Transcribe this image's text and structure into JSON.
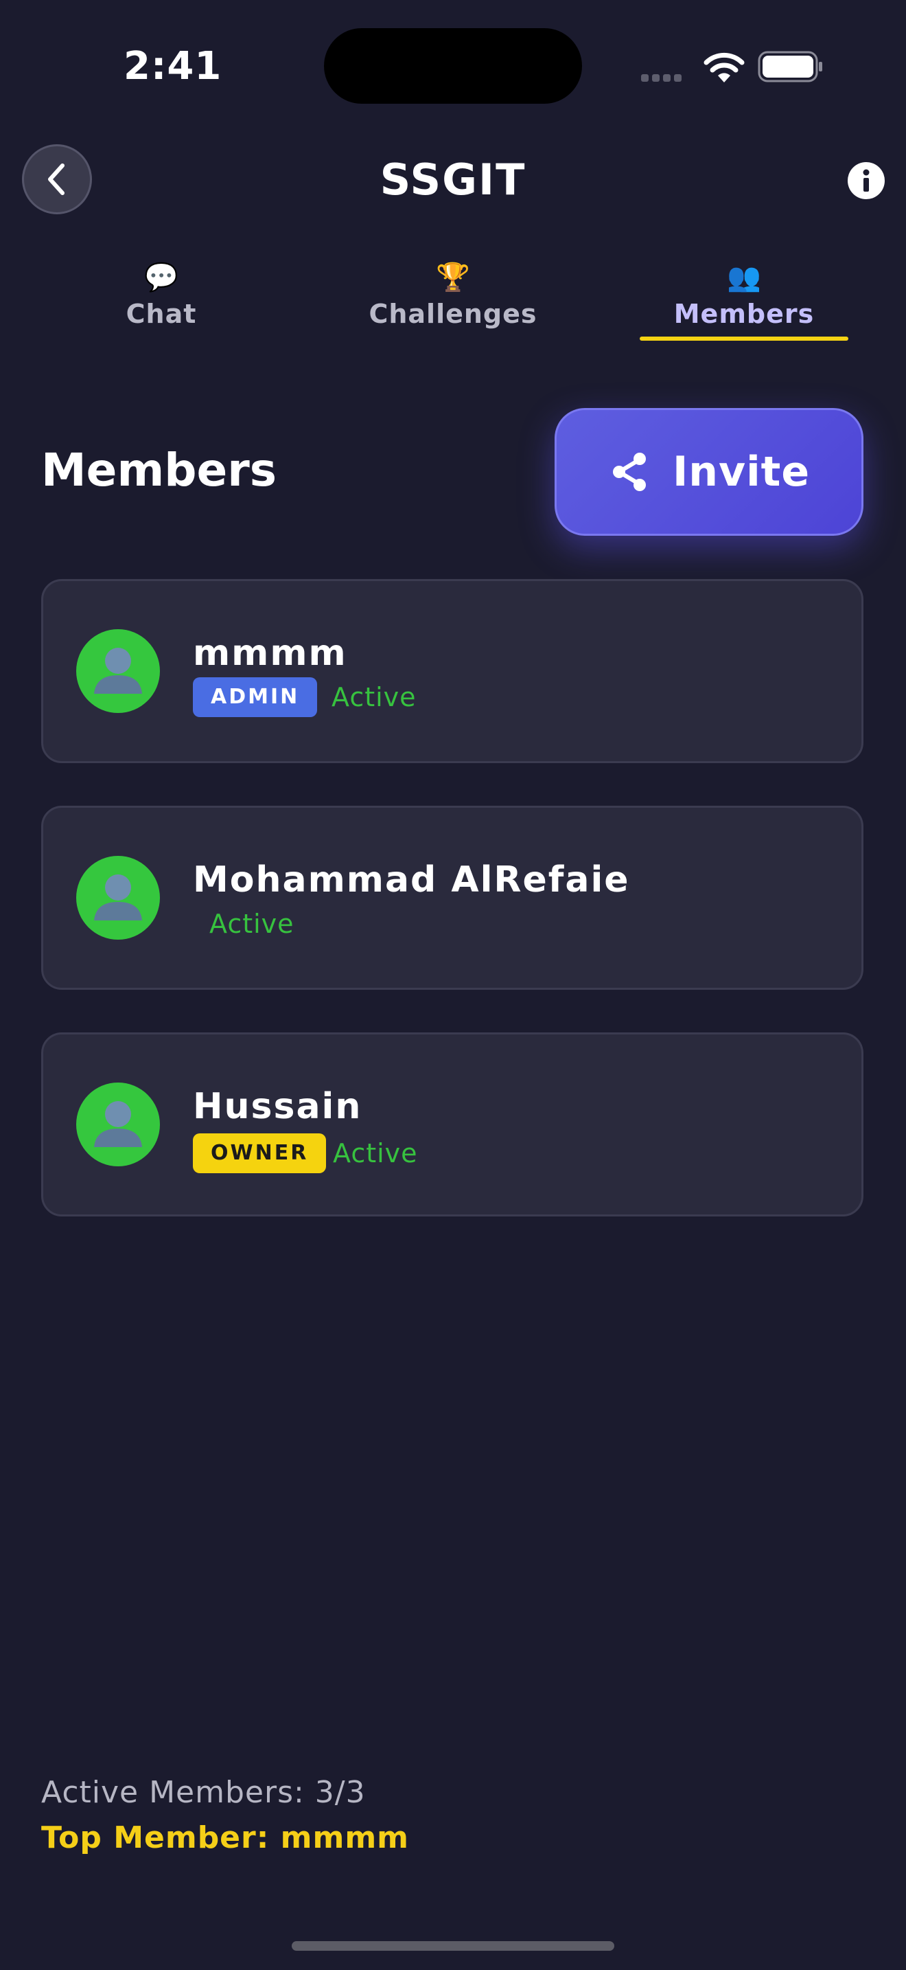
{
  "status_bar": {
    "time": "2:41"
  },
  "header": {
    "title": "SSGIT"
  },
  "tabs": [
    {
      "label": "Chat",
      "icon": "💬",
      "icon_name": "speech-bubble-icon",
      "active": false
    },
    {
      "label": "Challenges",
      "icon": "🏆",
      "icon_name": "trophy-icon",
      "active": false
    },
    {
      "label": "Members",
      "icon": "👥",
      "icon_name": "people-icon",
      "active": true
    }
  ],
  "section": {
    "title": "Members",
    "invite_label": "Invite"
  },
  "members": [
    {
      "name": "mmmm",
      "role": "ADMIN",
      "status": "Active"
    },
    {
      "name": "Mohammad AlRefaie",
      "role": "",
      "status": "Active"
    },
    {
      "name": "Hussain",
      "role": "OWNER",
      "status": "Active"
    }
  ],
  "footer": {
    "active_members": "Active Members: 3/3",
    "top_member": "Top Member: mmmm"
  },
  "colors": {
    "background": "#1b1b2e",
    "card": "#2a2a3d",
    "accent": "#5e5ee0",
    "tab_underline": "#f5d313",
    "status_active": "#37c23f",
    "admin_badge": "#4a6de3",
    "owner_badge": "#f5d30f",
    "avatar": "#35c73e"
  }
}
